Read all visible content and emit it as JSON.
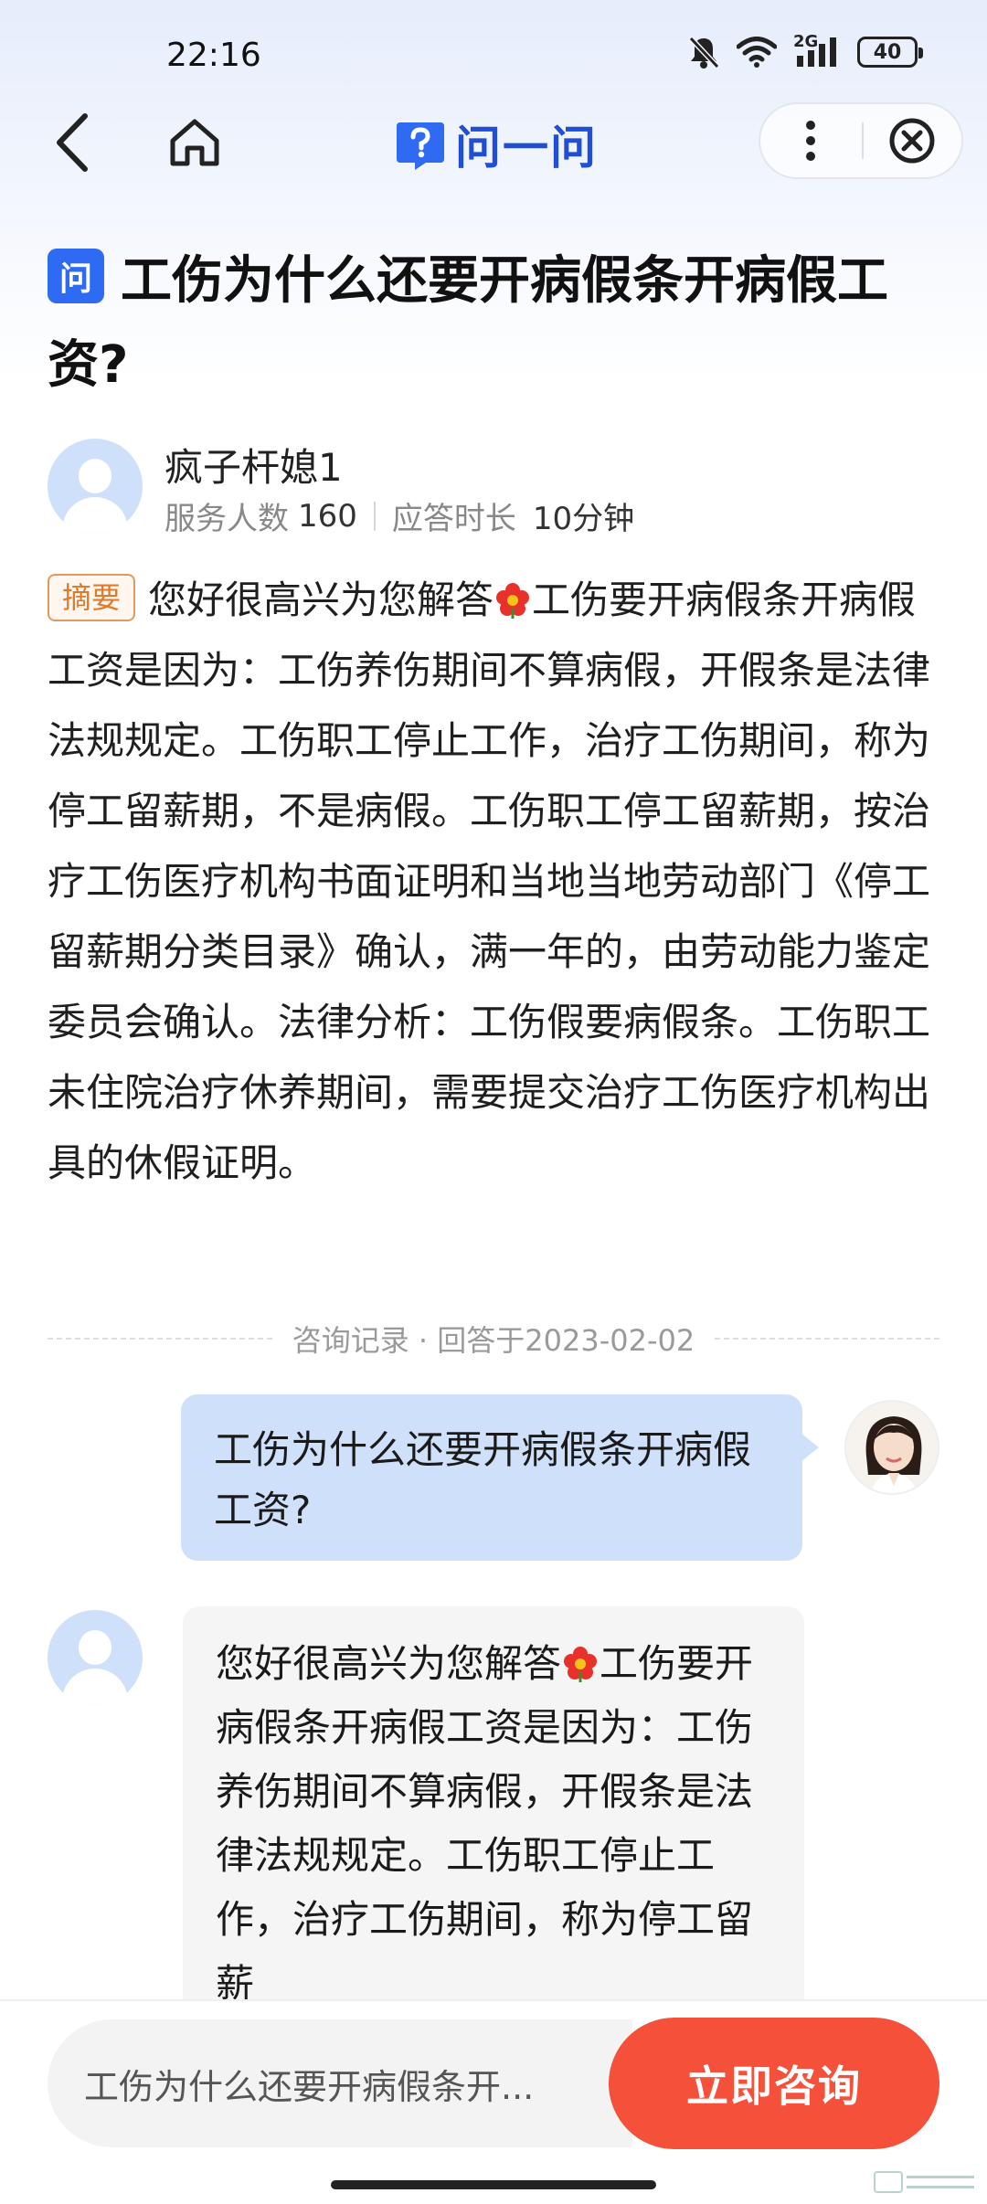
{
  "status_bar": {
    "time": "22:16",
    "signal_label": "2G",
    "battery": "40"
  },
  "nav": {
    "brand_text": "问一问",
    "icons": [
      "back-icon",
      "home-icon",
      "more-icon",
      "close-icon"
    ]
  },
  "question": {
    "badge": "问",
    "title": "工伤为什么还要开病假条开病假工资?"
  },
  "author": {
    "name": "疯子杆媳1",
    "served_label": "服务人数",
    "served_count": "160",
    "response_label": "应答时长",
    "response_time": "10分钟"
  },
  "summary": {
    "tag": "摘要",
    "text_before_flower": "您好很高兴为您解答",
    "text_after_flower": "工伤要开病假条开病假工资是因为：工伤养伤期间不算病假，开假条是法律法规规定。工伤职工停止工作，治疗工伤期间，称为停工留薪期，不是病假。工伤职工停工留薪期，按治疗工伤医疗机构书面证明和当地当地劳动部门《停工留薪期分类目录》确认，满一年的，由劳动能力鉴定委员会确认。法律分析：工伤假要病假条。工伤职工未住院治疗休养期间，需要提交治疗工伤医疗机构出具的休假证明。"
  },
  "record": {
    "text": "咨询记录 · 回答于2023-02-02"
  },
  "chat": {
    "user_message": "工伤为什么还要开病假条开病假工资?",
    "bot_text_before_flower": "您好很高兴为您解答",
    "bot_text_after_flower": "工伤要开病假条开病假工资是因为：工伤养伤期间不算病假，开假条是法律法规规定。工伤职工停止工作，治疗工伤期间，称为停工留薪"
  },
  "bottom": {
    "input_text": "工伤为什么还要开病假条开...",
    "consult_button": "立即咨询"
  },
  "colors": {
    "brand_blue": "#2f6bf2",
    "consult_red": "#f4503a",
    "user_bubble": "#cfe0fb",
    "bot_bubble": "#f5f5f5",
    "tag_orange": "#e07a2a"
  }
}
